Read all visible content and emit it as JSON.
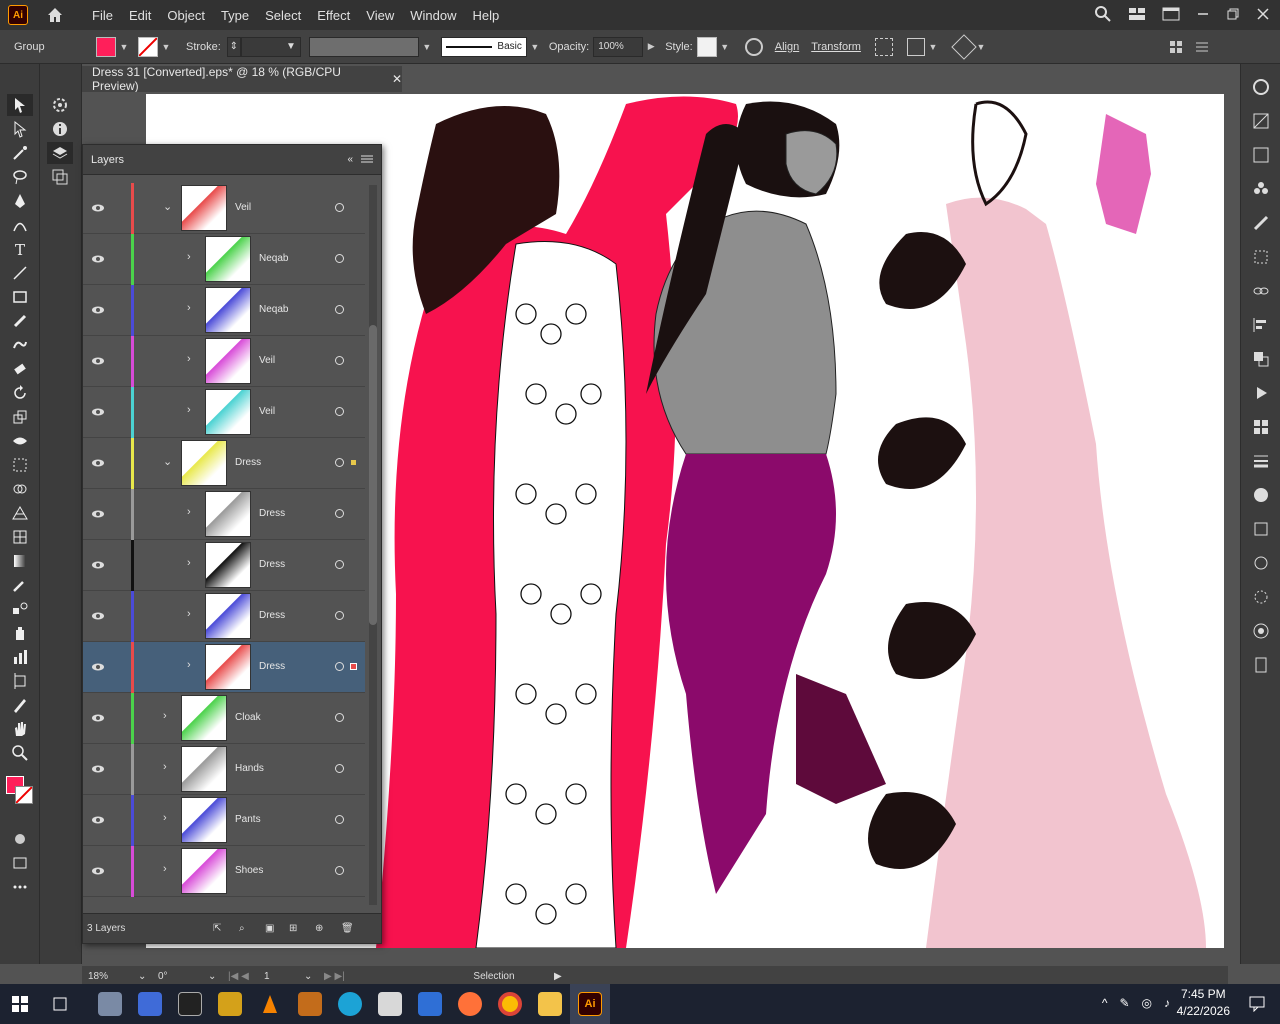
{
  "app": {
    "logo_text": "Ai"
  },
  "menu": [
    "File",
    "Edit",
    "Object",
    "Type",
    "Select",
    "Effect",
    "View",
    "Window",
    "Help"
  ],
  "control_bar": {
    "selection_label": "Group",
    "fill_color": "#ff1f5a",
    "stroke_label": "Stroke:",
    "brush_label": "Basic",
    "opacity_label": "Opacity:",
    "opacity_value": "100%",
    "style_label": "Style:",
    "align_label": "Align",
    "transform_label": "Transform"
  },
  "document_tab": {
    "title": "Dress 31 [Converted].eps* @ 18 % (RGB/CPU Preview)"
  },
  "layers_panel": {
    "title": "Layers",
    "footer_count": "3 Layers",
    "rows": [
      {
        "name": "Veil",
        "color": "#e84b4b",
        "indent": 1,
        "expanded": true
      },
      {
        "name": "Neqab",
        "color": "#4bd24b",
        "indent": 2,
        "expanded": false
      },
      {
        "name": "Neqab",
        "color": "#4b4bd8",
        "indent": 2,
        "expanded": false
      },
      {
        "name": "Veil",
        "color": "#d84bd8",
        "indent": 2,
        "expanded": false
      },
      {
        "name": "Veil",
        "color": "#4bd2d2",
        "indent": 2,
        "expanded": false
      },
      {
        "name": "Dress",
        "color": "#e8e84b",
        "indent": 1,
        "expanded": true
      },
      {
        "name": "Dress",
        "color": "#9a9a9a",
        "indent": 2,
        "expanded": false
      },
      {
        "name": "Dress",
        "color": "#111111",
        "indent": 2,
        "expanded": false
      },
      {
        "name": "Dress",
        "color": "#4b4bd8",
        "indent": 2,
        "expanded": false
      },
      {
        "name": "Dress",
        "color": "#e84b4b",
        "indent": 2,
        "expanded": false,
        "selected": true
      },
      {
        "name": "Cloak",
        "color": "#4bd24b",
        "indent": 1,
        "expanded": false
      },
      {
        "name": "Hands",
        "color": "#9a9a9a",
        "indent": 1,
        "expanded": false
      },
      {
        "name": "Pants",
        "color": "#4b4bd8",
        "indent": 1,
        "expanded": false
      },
      {
        "name": "Shoes",
        "color": "#d84bd8",
        "indent": 1,
        "expanded": false
      }
    ]
  },
  "status_bar": {
    "zoom": "18%",
    "rotation": "0°",
    "artboard": "1",
    "tool": "Selection"
  },
  "taskbar": {
    "time": "7:45 PM",
    "date": "4/22/2026"
  }
}
